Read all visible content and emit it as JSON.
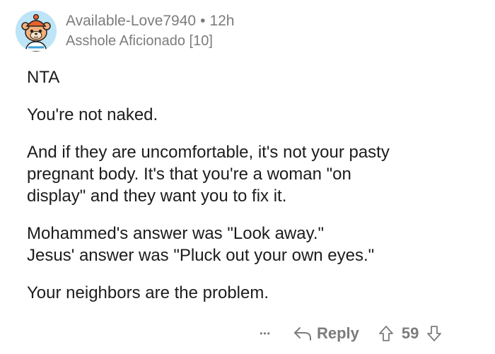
{
  "comment": {
    "author": {
      "username": "Available-Love7940",
      "separator": "•",
      "time": "12h",
      "flair": "Asshole Aficionado [10]",
      "avatar_icon": "snoo-avatar-icon"
    },
    "body": {
      "p1": "NTA",
      "p2": "You're not naked.",
      "p3_l1": "And if they are uncomfortable, it's not your pasty",
      "p3_l2": "pregnant body.  It's that you're a woman \"on",
      "p3_l3": "display\" and they want you to fix it.",
      "p4_l1": "Mohammed's answer was \"Look away.\"",
      "p4_l2": "Jesus' answer was \"Pluck out your own eyes.\"",
      "p5": "Your neighbors are the problem."
    },
    "footer": {
      "more_label": "•••",
      "reply_label": "Reply",
      "score": "59"
    }
  },
  "colors": {
    "meta_gray": "#7c7c7c",
    "text": "#1c1c1c",
    "avatar_bg": "#bde4f7"
  }
}
